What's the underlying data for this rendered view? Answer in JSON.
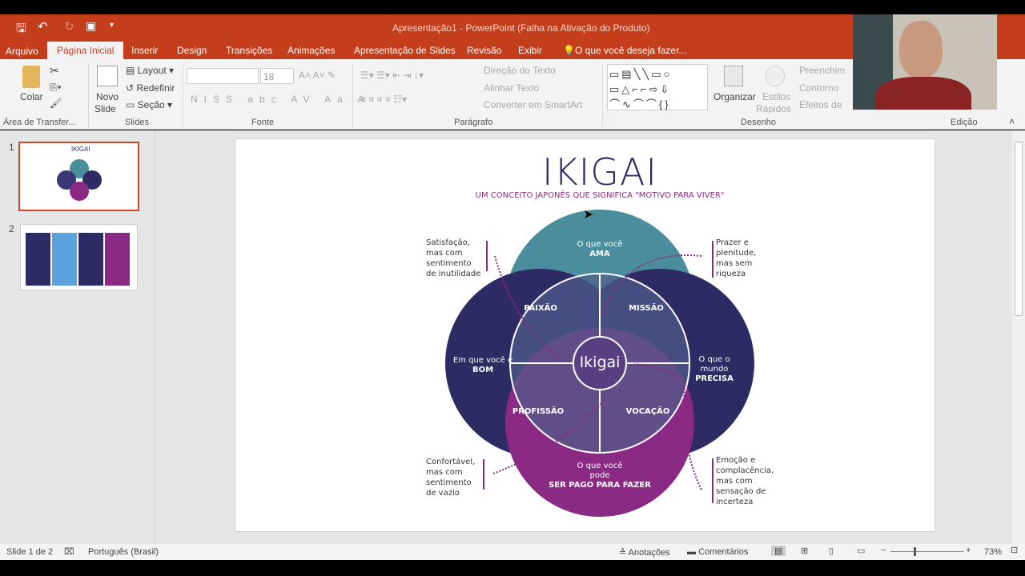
{
  "window": {
    "title": "Apresentação1 - PowerPoint (Falha na Ativação do Produto)"
  },
  "tabs": [
    "Arquivo",
    "Página Inicial",
    "Inserir",
    "Design",
    "Transições",
    "Animações",
    "Apresentação de Slides",
    "Revisão",
    "Exibir"
  ],
  "tell_me": "O que você deseja fazer...",
  "ribbon": {
    "colar": "Colar",
    "novo": "Novo",
    "slide": "Slide",
    "layout": "Layout",
    "redefinir": "Redefinir",
    "secao": "Seção",
    "font_size": "18",
    "direcao": "Direção do Texto",
    "alinhar": "Alinhar Texto",
    "converter": "Converter em SmartArt",
    "organizar": "Organizar",
    "estilos": "Estilos",
    "rapidos": "Rápidos",
    "preench": "Preenchim",
    "contorno": "Contorno",
    "efeitos": "Efeitos de",
    "groups": [
      "Área de Transfer...",
      "Slides",
      "Fonte",
      "Parágrafo",
      "Desenho",
      "Edição"
    ]
  },
  "thumbnails": [
    {
      "num": "1",
      "selected": true
    },
    {
      "num": "2",
      "selected": false
    }
  ],
  "slide": {
    "title": "IKIGAI",
    "subtitle": "UM CONCEITO JAPONÊS QUE SIGNIFICA \"MOTIVO PARA VIVER\"",
    "center": "Ikigai",
    "ama": [
      "O que você",
      "AMA"
    ],
    "bom": [
      "Em que você é",
      "BOM"
    ],
    "precisa": [
      "O que o",
      "mundo",
      "PRECISA"
    ],
    "pago": [
      "O que você",
      "pode",
      "SER PAGO PARA FAZER"
    ],
    "paixao": "PAIXÃO",
    "missao": "MISSÃO",
    "profissao": "PROFISSÃO",
    "vocacao": "VOCAÇÃO",
    "notes": {
      "tl": [
        "Satisfação,",
        "mas com",
        "sentimento",
        "de inutilidade"
      ],
      "tr": [
        "Prazer e",
        "plenitude,",
        "mas sem",
        "riqueza"
      ],
      "bl": [
        "Confortável,",
        "mas com",
        "sentimento",
        "de vazio"
      ],
      "br": [
        "Emoção e",
        "complacência,",
        "mas com",
        "sensação de",
        "incerteza"
      ]
    },
    "colors": {
      "teal": "#4a8d9c",
      "navy": "#2e2a64",
      "magenta": "#8a2a84",
      "title": "#2e2a64",
      "subtitle": "#8d2a7e"
    }
  },
  "status": {
    "slide": "Slide 1 de 2",
    "language": "Português (Brasil)",
    "notes": "Anotações",
    "comments": "Comentários",
    "zoom": "73%"
  }
}
